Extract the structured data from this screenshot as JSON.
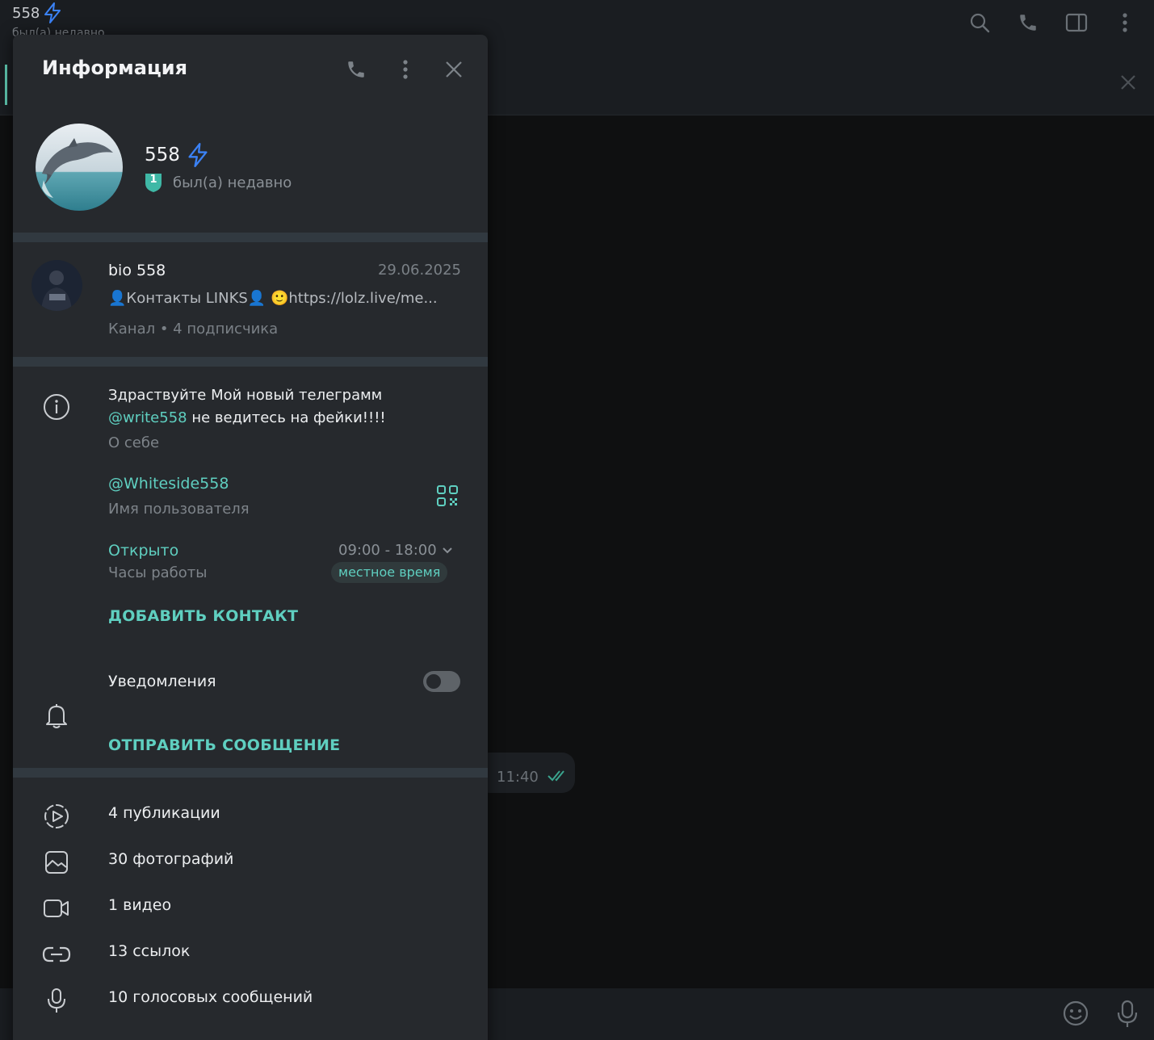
{
  "background_chat": {
    "title": "558",
    "subtitle": "был(а) недавно",
    "message_time": "11:40"
  },
  "panel": {
    "title": "Информация",
    "profile": {
      "name": "558",
      "status": "был(а) недавно",
      "badge_number": "1"
    },
    "channel": {
      "name": "bio 558",
      "date": "29.06.2025",
      "description": "👤Контакты LINKS👤  🙂https://lolz.live/me...",
      "meta": "Канал • 4 подписчика"
    },
    "about": {
      "text_part1": "Здраствуйте Мой новый телеграмм ",
      "mention": "@write558",
      "text_part2": " не ведитесь на фейки!!!!",
      "label": "О себе"
    },
    "username": {
      "value": "@Whiteside558",
      "label": "Имя пользователя"
    },
    "hours": {
      "status": "Открыто",
      "label": "Часы работы",
      "time": "09:00 - 18:00",
      "local_time_badge": "местное время"
    },
    "add_contact": "ДОБАВИТЬ КОНТАКТ",
    "notifications": {
      "label": "Уведомления",
      "enabled": false
    },
    "send_message": "ОТПРАВИТЬ СООБЩЕНИЕ",
    "media": [
      {
        "icon": "stories-icon",
        "label": "4 публикации"
      },
      {
        "icon": "photo-icon",
        "label": "30 фотографий"
      },
      {
        "icon": "video-icon",
        "label": "1 видео"
      },
      {
        "icon": "link-icon",
        "label": "13 ссылок"
      },
      {
        "icon": "microphone-icon",
        "label": "10 голосовых сообщений"
      }
    ]
  },
  "colors": {
    "accent": "#5fcfc0",
    "panel_bg": "#26292d",
    "premium_bolt": "#3b82f6"
  }
}
